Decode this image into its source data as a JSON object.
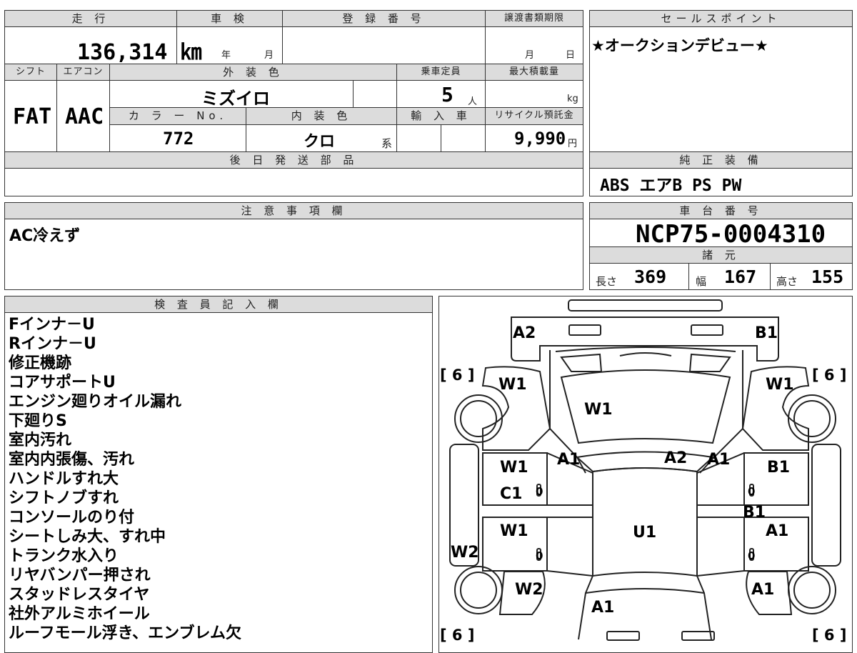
{
  "top_info": {
    "mileage_label": "走 行",
    "mileage_value": "136,314 ㎞",
    "inspection_label": "車 検",
    "inspection_year_unit": "年",
    "inspection_month_unit": "月",
    "registration_label": "登 録 番 号",
    "transfer_deadline_label": "譲渡書類期限",
    "transfer_month_unit": "月",
    "transfer_day_unit": "日",
    "shift_label": "シフト",
    "ac_label": "エアコン",
    "exterior_color_label": "外 装 色",
    "capacity_label": "乗車定員",
    "max_load_label": "最大積載量",
    "shift_value": "FAT",
    "ac_value": "AAC",
    "exterior_color_value": "ミズイロ",
    "capacity_value": "5",
    "capacity_unit": "人",
    "max_load_unit": "kg",
    "color_no_label": "カ ラ ー No.",
    "interior_color_label": "内 装 色",
    "import_label": "輸 入 車",
    "recycle_label": "リサイクル預託金",
    "color_no_value": "772",
    "interior_color_value": "クロ",
    "interior_color_unit": "系",
    "recycle_value": "9,990",
    "recycle_unit": "円",
    "later_parts_label": "後 日 発 送 部 品"
  },
  "sales_point": {
    "label": "セールスポイント",
    "value": "★オークションデビュー★"
  },
  "equipment": {
    "label": "純 正 装 備",
    "value": "ABS エアB PS PW"
  },
  "notes": {
    "label": "注 意 事 項 欄",
    "value": "AC冷えず"
  },
  "chassis": {
    "label": "車 台 番 号",
    "value": "NCP75-0004310",
    "specs_label": "諸 元",
    "length_label": "長さ",
    "length_value": "369",
    "width_label": "幅",
    "width_value": "167",
    "height_label": "高さ",
    "height_value": "155"
  },
  "inspector": {
    "label": "検 査 員 記 入 欄",
    "items": [
      "Fインナ－U",
      "Rインナ－U",
      "修正機跡",
      "コアサポートU",
      "エンジン廻りオイル漏れ",
      "下廻りS",
      "室内汚れ",
      "室内内張傷、汚れ",
      "ハンドルすれ大",
      "シフトノブすれ",
      "コンソールのり付",
      "シートしみ大、すれ中",
      "トランク水入り",
      "リヤバンパー押され",
      "スタッドレスタイヤ",
      "社外アルミホイール",
      "ルーフモール浮き、エンブレム欠"
    ]
  },
  "diagram": {
    "tire_marks": [
      "[ 6 ]",
      "[ 6 ]",
      "[ 6 ]",
      "[ 6 ]"
    ],
    "codes": {
      "front_left_corner": "A2",
      "front_right_corner": "B1",
      "left_front_fender": "W1",
      "right_front_fender": "W1",
      "hood": "W1",
      "left_pillar": "A1",
      "roof_front": "A2",
      "right_pillar": "A1",
      "left_front_door_1": "W1",
      "left_front_door_2": "C1",
      "right_front_door": "B1",
      "right_center_pillar": "B1",
      "left_rear_door": "W1",
      "roof": "U1",
      "right_rear_door": "A1",
      "left_rocker": "W2",
      "left_rear_fender": "W2",
      "right_rear_fender": "A1",
      "rear": "A1"
    },
    "zeros": [
      "0",
      "0",
      "0",
      "0"
    ]
  }
}
